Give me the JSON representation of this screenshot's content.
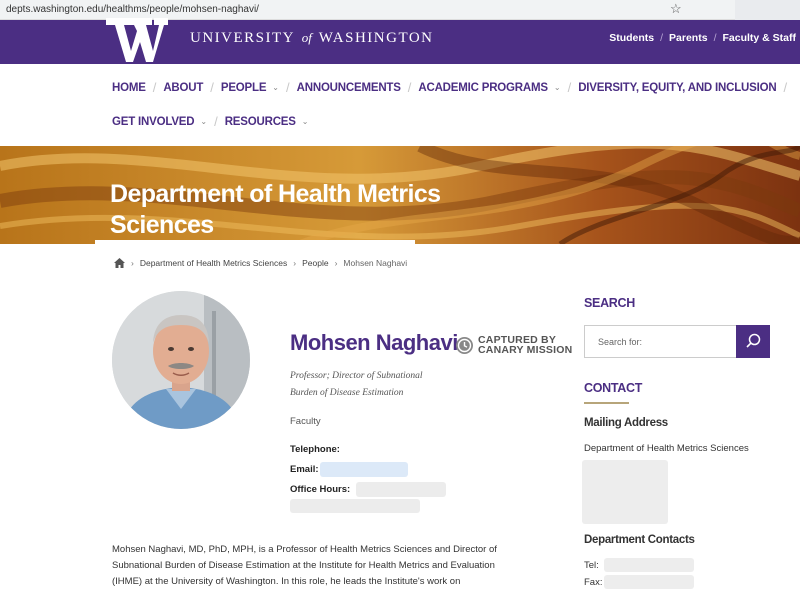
{
  "browser": {
    "url": "depts.washington.edu/healthms/people/mohsen-naghavi/"
  },
  "header": {
    "university_name_part1": "UNIVERSITY",
    "university_name_of": "of",
    "university_name_part2": "WASHINGTON",
    "top_links": [
      "Students",
      "Parents",
      "Faculty & Staff"
    ],
    "brand_color": "#4b2e83"
  },
  "nav": {
    "row1": [
      {
        "label": "HOME",
        "dropdown": false
      },
      {
        "label": "ABOUT",
        "dropdown": false
      },
      {
        "label": "PEOPLE",
        "dropdown": true
      },
      {
        "label": "ANNOUNCEMENTS",
        "dropdown": false
      },
      {
        "label": "ACADEMIC PROGRAMS",
        "dropdown": true
      },
      {
        "label": "DIVERSITY, EQUITY, AND INCLUSION",
        "dropdown": false
      }
    ],
    "row2": [
      {
        "label": "GET INVOLVED",
        "dropdown": true
      },
      {
        "label": "RESOURCES",
        "dropdown": true
      }
    ]
  },
  "banner": {
    "line1": "Department of Health Metrics",
    "line2": "Sciences"
  },
  "breadcrumb": [
    "Department of Health Metrics Sciences",
    "People",
    "Mohsen Naghavi"
  ],
  "profile": {
    "name": "Mohsen Naghavi",
    "badge_line1": "CAPTURED BY",
    "badge_line2": "CANARY MISSION",
    "title_line1": "Professor; Director of Subnational",
    "title_line2": "Burden of Disease Estimation",
    "role": "Faculty",
    "telephone_label": "Telephone:",
    "email_label": "Email:",
    "office_hours_label": "Office Hours:",
    "bio_line1": "Mohsen Naghavi, MD, PhD, MPH, is a Professor of Health Metrics Sciences and Director of",
    "bio_line2": "Subnational Burden of Disease Estimation at the Institute for Health Metrics and Evaluation",
    "bio_line3": "(IHME) at the University of Washington. In this role, he leads the Institute's work on"
  },
  "sidebar": {
    "search_heading": "SEARCH",
    "search_placeholder": "Search for:",
    "contact_heading": "CONTACT",
    "mailing_heading": "Mailing Address",
    "mailing_line1": "Department of Health Metrics Sciences",
    "dept_contacts_heading": "Department Contacts",
    "tel_label": "Tel:",
    "fax_label": "Fax:"
  }
}
